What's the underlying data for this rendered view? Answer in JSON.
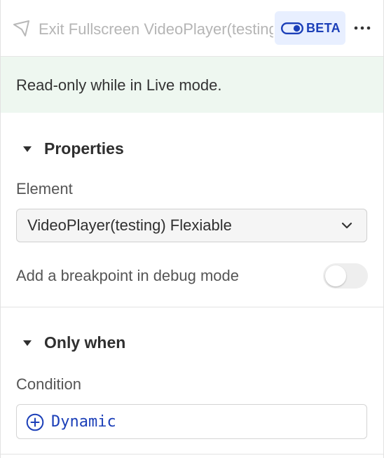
{
  "header": {
    "title": "Exit Fullscreen VideoPlayer(testing) Flexiable",
    "beta_label": "BETA",
    "icons": {
      "cursor": "cursor-arrow-icon",
      "toggle": "toggle-icon",
      "more": "more-horizontal-icon"
    }
  },
  "notice": {
    "text": "Read-only while in Live mode."
  },
  "properties": {
    "title": "Properties",
    "element_label": "Element",
    "element_value": "VideoPlayer(testing) Flexiable",
    "breakpoint_label": "Add a breakpoint in debug mode",
    "breakpoint_enabled": false
  },
  "only_when": {
    "title": "Only when",
    "condition_label": "Condition",
    "condition_value": "Dynamic"
  },
  "colors": {
    "accent": "#1b3fb8",
    "beta_bg": "#e8efff",
    "notice_bg": "#eef7f0",
    "muted_title": "#b5b5b5"
  }
}
